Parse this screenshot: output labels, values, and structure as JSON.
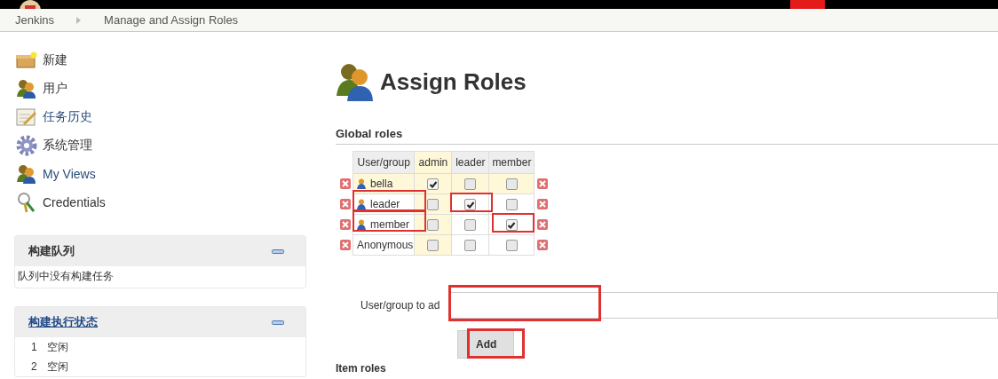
{
  "breadcrumbs": [
    "Jenkins",
    "Manage and Assign Roles"
  ],
  "sidebar": {
    "items": [
      {
        "label": "新建"
      },
      {
        "label": "用户"
      },
      {
        "label": "任务历史"
      },
      {
        "label": "系统管理"
      },
      {
        "label": "My Views"
      },
      {
        "label": "Credentials"
      }
    ]
  },
  "panels": [
    {
      "title": "构建队列",
      "link": false,
      "rows": [
        {
          "number": "",
          "text": "队列中没有构建任务"
        }
      ]
    },
    {
      "title": "构建执行状态",
      "link": true,
      "rows": [
        {
          "number": "1",
          "text": "空闲"
        },
        {
          "number": "2",
          "text": "空闲"
        }
      ]
    }
  ],
  "page_title": "Assign Roles",
  "global_roles": {
    "heading": "Global roles",
    "columns": [
      "User/group",
      "admin",
      "leader",
      "member"
    ],
    "rows": [
      {
        "name": "bella",
        "user_icon": true,
        "selected": true,
        "highlighted": false,
        "roles": [
          {
            "checked": true,
            "highlighted": false
          },
          {
            "checked": false,
            "highlighted": false
          },
          {
            "checked": false,
            "highlighted": false
          }
        ]
      },
      {
        "name": "leader",
        "user_icon": true,
        "selected": false,
        "highlighted": true,
        "roles": [
          {
            "checked": false,
            "highlighted": false
          },
          {
            "checked": true,
            "highlighted": true
          },
          {
            "checked": false,
            "highlighted": false
          }
        ]
      },
      {
        "name": "member",
        "user_icon": true,
        "selected": false,
        "highlighted": true,
        "roles": [
          {
            "checked": false,
            "highlighted": false
          },
          {
            "checked": false,
            "highlighted": false
          },
          {
            "checked": true,
            "highlighted": true
          }
        ]
      },
      {
        "name": "Anonymous",
        "user_icon": false,
        "selected": false,
        "highlighted": false,
        "roles": [
          {
            "checked": false,
            "highlighted": false
          },
          {
            "checked": false,
            "highlighted": false
          },
          {
            "checked": false,
            "highlighted": false
          }
        ]
      }
    ],
    "add_label": "User/group to ad",
    "add_field_highlighted": true,
    "add_button": "Add",
    "add_button_highlighted": true
  },
  "next_section": "Item roles"
}
